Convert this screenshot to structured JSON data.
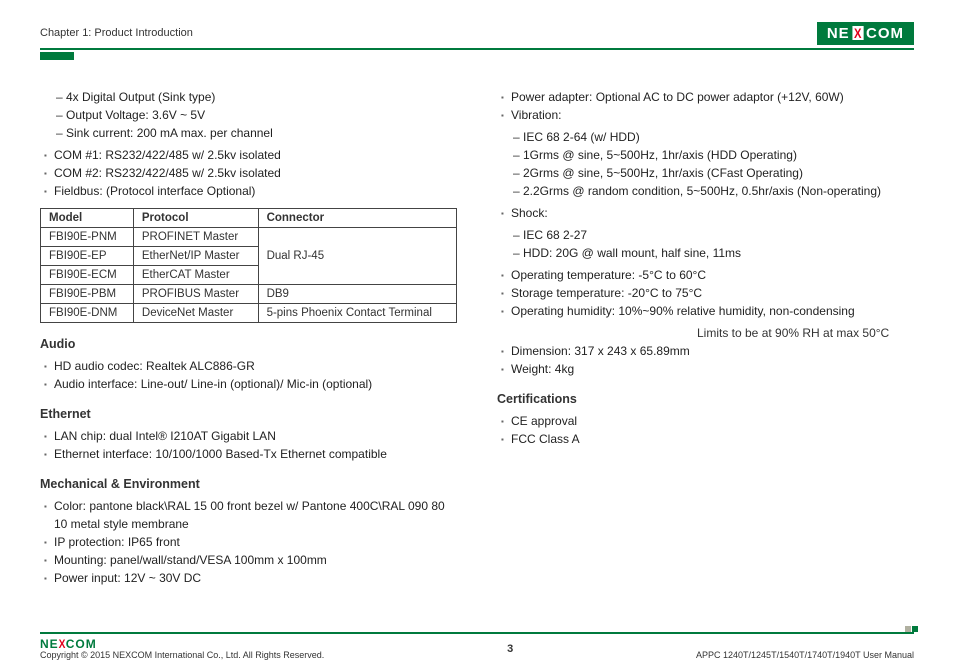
{
  "header": {
    "chapter": "Chapter 1: Product Introduction",
    "logo_left": "NE",
    "logo_x": "X",
    "logo_right": "COM"
  },
  "left": {
    "pre_dash": [
      "4x Digital Output (Sink type)",
      "Output Voltage: 3.6V ~ 5V",
      "Sink current: 200 mA max. per channel"
    ],
    "pre_bullets": [
      "COM #1: RS232/422/485 w/ 2.5kv isolated",
      "COM #2: RS232/422/485 w/ 2.5kv isolated",
      "Fieldbus: (Protocol interface Optional)"
    ],
    "table": {
      "headers": [
        "Model",
        "Protocol",
        "Connector"
      ],
      "rows": [
        {
          "model": "FBI90E-PNM",
          "protocol": "PROFINET Master"
        },
        {
          "model": "FBI90E-EP",
          "protocol": "EtherNet/IP Master"
        },
        {
          "model": "FBI90E-ECM",
          "protocol": "EtherCAT Master"
        },
        {
          "model": "FBI90E-PBM",
          "protocol": "PROFIBUS Master",
          "connector": "DB9"
        },
        {
          "model": "FBI90E-DNM",
          "protocol": "DeviceNet Master",
          "connector": "5-pins Phoenix Contact Terminal"
        }
      ],
      "connector_group1": "Dual RJ-45"
    },
    "audio_h": "Audio",
    "audio_items": [
      "HD audio codec: Realtek ALC886-GR",
      "Audio interface: Line-out/ Line-in (optional)/ Mic-in (optional)"
    ],
    "eth_h": "Ethernet",
    "eth_items": [
      "LAN chip: dual Intel® I210AT Gigabit LAN",
      "Ethernet interface: 10/100/1000 Based-Tx Ethernet compatible"
    ],
    "mech_h": "Mechanical & Environment",
    "mech_items": [
      "Color: pantone black\\RAL 15 00 front bezel w/ Pantone 400C\\RAL 090 80 10 metal style membrane",
      "IP protection: IP65 front",
      "Mounting: panel/wall/stand/VESA 100mm x 100mm",
      "Power input: 12V ~ 30V DC"
    ]
  },
  "right": {
    "b0": "Power adapter: Optional AC to DC power adaptor (+12V, 60W)",
    "b1": "Vibration:",
    "b1_sub": [
      "IEC 68 2-64 (w/ HDD)",
      "1Grms @ sine, 5~500Hz, 1hr/axis (HDD Operating)",
      "2Grms @ sine, 5~500Hz, 1hr/axis (CFast Operating)",
      "2.2Grms @ random condition, 5~500Hz, 0.5hr/axis (Non-operating)"
    ],
    "b2": "Shock:",
    "b2_sub": [
      "IEC 68 2-27",
      "HDD: 20G @ wall mount, half sine, 11ms"
    ],
    "b3": "Operating temperature: -5°C to 60°C",
    "b4": "Storage temperature: -20°C to 75°C",
    "b5": "Operating humidity: 10%~90% relative humidity, non-condensing",
    "b5_note": "Limits to be at 90% RH at max 50°C",
    "b6": "Dimension: 317 x 243 x 65.89mm",
    "b7": "Weight: 4kg",
    "cert_h": "Certifications",
    "cert_items": [
      "CE approval",
      "FCC Class A"
    ]
  },
  "footer": {
    "logo_left": "NE",
    "logo_x": "X",
    "logo_right": "COM",
    "copyright": "Copyright © 2015 NEXCOM International Co., Ltd. All Rights Reserved.",
    "page": "3",
    "manual": "APPC 1240T/1245T/1540T/1740T/1940T User Manual"
  }
}
